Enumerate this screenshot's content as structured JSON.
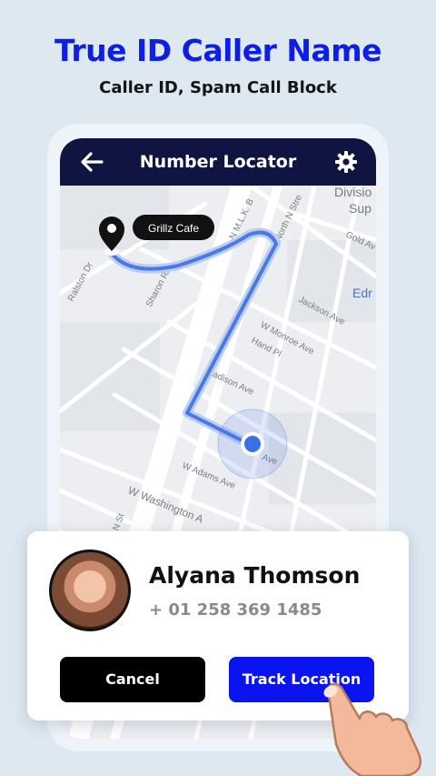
{
  "headline": "True ID Caller Name",
  "subheadline": "Caller ID, Spam Call Block",
  "appbar": {
    "title": "Number Locator",
    "back_icon": "arrow-left-icon",
    "settings_icon": "gear-icon"
  },
  "map": {
    "place_label": "Grillz Cafe",
    "streets": [
      "N M.L.K. B",
      "North N Stre",
      "Divisio",
      "Sup",
      "Gold Av",
      "Ralston Dr",
      "Sharon Rd",
      "Jackson Ave",
      "Edr",
      "W Monroe Ave",
      "Hand Pl",
      "Madison Ave",
      "Ave",
      "W Adams Ave",
      "W Washington A",
      "N St"
    ],
    "route_color": "#4a78e8"
  },
  "caller": {
    "name": "Alyana Thomson",
    "number": "+ 01 258 369 1485"
  },
  "buttons": {
    "cancel": "Cancel",
    "track": "Track Location"
  },
  "colors": {
    "headline": "#0d1ee6",
    "appbar": "#0f1540",
    "track_button": "#0a14ee",
    "cancel_button": "#000000"
  }
}
